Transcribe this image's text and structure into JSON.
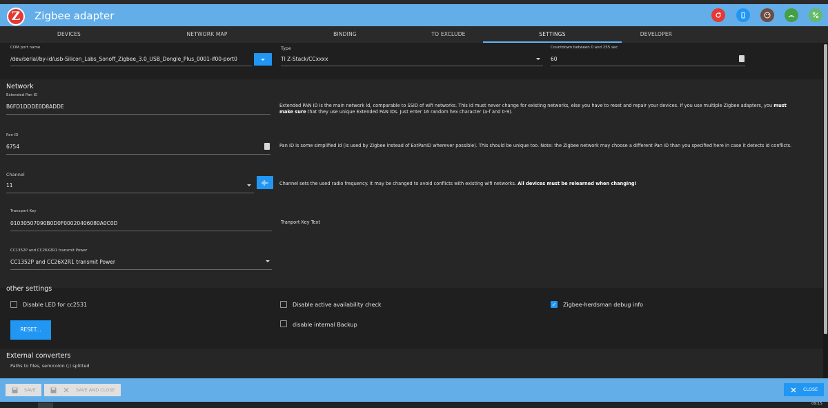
{
  "app": {
    "title": "Zigbee adapter",
    "logo_letter": "Z"
  },
  "header_buttons": [
    {
      "icon": "refresh-icon",
      "color": "#e53935"
    },
    {
      "icon": "phone-icon",
      "color": "#2196f3"
    },
    {
      "icon": "face-icon",
      "color": "#6d4c41"
    },
    {
      "icon": "broadcast-icon",
      "color": "#43a047"
    },
    {
      "icon": "percent-icon",
      "color": "#66bb6a"
    }
  ],
  "tabs": [
    "DEVICES",
    "NETWORK MAP",
    "BINDING",
    "TO EXCLUDE",
    "SETTINGS",
    "DEVELOPER"
  ],
  "active_tab": "SETTINGS",
  "com_port": {
    "label": "COM port name",
    "value": "/dev/serial/by-id/usb-Silicon_Labs_Sonoff_Zigbee_3.0_USB_Dongle_Plus_0001-if00-port0"
  },
  "type": {
    "label": "Type",
    "value": "TI Z-Stack/CCxxxx"
  },
  "countdown": {
    "label": "Countdown between 0 and 255 sec",
    "value": "60"
  },
  "network": {
    "title": "Network",
    "ext_pan": {
      "label": "Extended Pan ID",
      "value": "B6FD1DDDE0D8ADDE",
      "desc_1": "Extended PAN ID is the main network id, comparable to SSID of wifi networks. This id must never change for existing networks, else you have to reset and repair your devices. If you use multiple Zigbee adapters, you",
      "desc_bold_1": "must",
      "desc_bold_2": "make sure",
      "desc_2": "that they use unique Extended PAN IDs. Just enter 16 random hex character (a-f and 0-9)."
    },
    "pan": {
      "label": "Pan ID",
      "value": "6754",
      "desc": "Pan ID is some simplified id (is used by Zigbee instead of ExtPanID wherever possible). This should be unique too. Note: the Zigbee network may choose a different Pan ID than you specified here in case it detects id conflicts."
    },
    "channel": {
      "label": "Channel",
      "value": "11",
      "desc": "Channel sets the used radio frequency. It may be changed to avoid conflicts with existing wifi networks.",
      "desc_bold": "All devices must be relearned when changing!"
    },
    "transport": {
      "label": "Transport Key",
      "value": "01030507090B0D0F00020406080A0C0D",
      "desc": "Tranport Key Text"
    },
    "power": {
      "label": "CC1352P and CC26X2R1 transmit Power",
      "value": "CC1352P and CC26X2R1 transmit Power"
    }
  },
  "other": {
    "title": "other settings",
    "disable_led": {
      "label": "Disable LED for cc2531",
      "checked": false
    },
    "disable_availability": {
      "label": "Disable active availability check",
      "checked": false
    },
    "disable_backup": {
      "label": "disable internal Backup",
      "checked": false
    },
    "debug_info": {
      "label": "Zigbee-herdsman debug info",
      "checked": true
    },
    "reset_label": "RESET..."
  },
  "external": {
    "title": "External converters",
    "label": "Paths to files, semicolon (;) splitted"
  },
  "footer": {
    "save": "SAVE",
    "save_close": "SAVE AND CLOSE",
    "close": "CLOSE"
  },
  "taskbar": {
    "clock": "09:15"
  }
}
